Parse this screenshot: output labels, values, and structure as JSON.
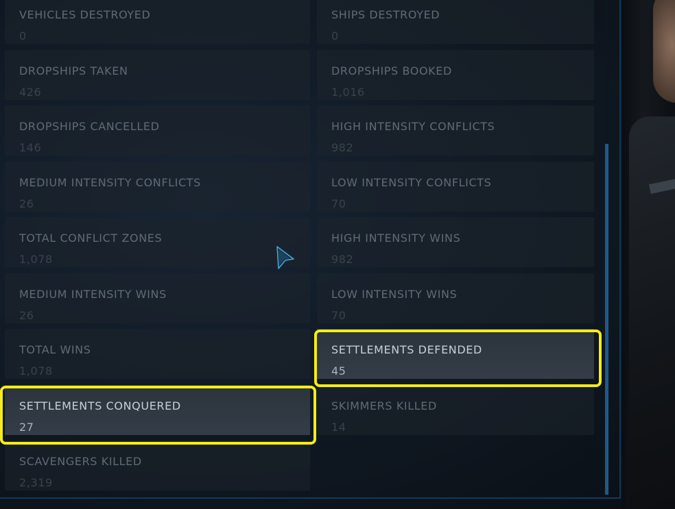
{
  "stats": [
    {
      "label": "VEHICLES DESTROYED",
      "value": "0",
      "active": false
    },
    {
      "label": "SHIPS DESTROYED",
      "value": "0",
      "active": false
    },
    {
      "label": "DROPSHIPS TAKEN",
      "value": "426",
      "active": false
    },
    {
      "label": "DROPSHIPS BOOKED",
      "value": "1,016",
      "active": false
    },
    {
      "label": "DROPSHIPS CANCELLED",
      "value": "146",
      "active": false
    },
    {
      "label": "HIGH INTENSITY CONFLICTS",
      "value": "982",
      "active": false
    },
    {
      "label": "MEDIUM INTENSITY CONFLICTS",
      "value": "26",
      "active": false
    },
    {
      "label": "LOW INTENSITY CONFLICTS",
      "value": "70",
      "active": false
    },
    {
      "label": "TOTAL CONFLICT ZONES",
      "value": "1,078",
      "active": false
    },
    {
      "label": "HIGH INTENSITY WINS",
      "value": "982",
      "active": false
    },
    {
      "label": "MEDIUM INTENSITY WINS",
      "value": "26",
      "active": false
    },
    {
      "label": "LOW INTENSITY WINS",
      "value": "70",
      "active": false
    },
    {
      "label": "TOTAL WINS",
      "value": "1,078",
      "active": false
    },
    {
      "label": "SETTLEMENTS DEFENDED",
      "value": "45",
      "active": true
    },
    {
      "label": "SETTLEMENTS CONQUERED",
      "value": "27",
      "active": true
    },
    {
      "label": "SKIMMERS KILLED",
      "value": "14",
      "active": false
    },
    {
      "label": "SCAVENGERS KILLED",
      "value": "2,319",
      "active": false
    }
  ],
  "colors": {
    "highlight": "#f5ee13",
    "scrollbar": "#1e5a88",
    "cursor": "#4aa8d8"
  },
  "icons": {
    "cursor": "pointer-arrow-icon"
  }
}
